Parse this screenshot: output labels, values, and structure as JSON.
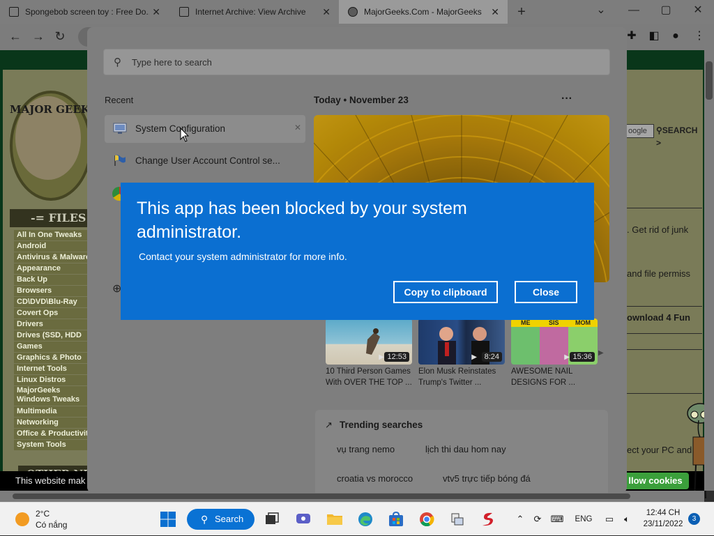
{
  "browser": {
    "tabs": [
      {
        "title": "Spongebob screen toy : Free Do...",
        "active": false
      },
      {
        "title": "Internet Archive: View Archive",
        "active": false
      },
      {
        "title": "MajorGeeks.Com - MajorGeeks",
        "active": true
      }
    ],
    "new_tab_symbol": "+",
    "window_controls": {
      "dropdown": "⌄",
      "minimize": "—",
      "maximize": "▢",
      "close": "✕"
    },
    "nav": {
      "back": "←",
      "forward": "→",
      "reload": "↻"
    },
    "toolbar_icons": [
      "extensions-icon",
      "sidebar-icon",
      "profile-icon",
      "menu-icon"
    ]
  },
  "website": {
    "logo_text": "MAJOR GEEK",
    "files_header": "-= FILES",
    "menu": [
      "All In One Tweaks",
      "Android",
      "Antivirus & Malware",
      "Appearance",
      "Back Up",
      "Browsers",
      "CD\\DVD\\Blu-Ray",
      "Covert Ops",
      "Drivers",
      "Drives (SSD, HDD",
      "Games",
      "Graphics & Photo",
      "Internet Tools",
      "Linux Distros",
      "MajorGeeks Windows Tweaks",
      "Multimedia",
      "Networking",
      "Office & Productivity",
      "System Tools"
    ],
    "other_header": "OTHER NE",
    "search_box": "oogle",
    "search_link": "SEARCH >",
    "right_snippets": [
      ". Get rid of junk",
      "and file permiss",
      "ownload 4 Fun",
      "ect your PC and"
    ],
    "cookie_text": "This website mak",
    "cookie_button": "llow cookies"
  },
  "start_panel": {
    "search_placeholder": "Type here to search",
    "recent_title": "Recent",
    "recent_items": [
      {
        "label": "System Configuration",
        "icon": "system-config-icon"
      },
      {
        "label": "Change User Account Control se...",
        "icon": "uac-flag-icon"
      }
    ],
    "recent_close": "✕",
    "today_label": "Today",
    "today_separator": "•",
    "today_date": "November 23",
    "more_symbol": "···",
    "videos": [
      {
        "duration": "12:53",
        "caption_line1": "10 Third Person Games",
        "caption_line2": "With OVER THE TOP ..."
      },
      {
        "duration": "8:24",
        "caption_line1": "Elon Musk Reinstates",
        "caption_line2": "Trump's Twitter ..."
      },
      {
        "duration": "15:36",
        "caption_line1": "AWESOME NAIL",
        "caption_line2": "DESIGNS FOR ..."
      }
    ],
    "video3_overlay": [
      "ME",
      "SIS",
      "MOM"
    ],
    "trending_title": "Trending searches",
    "trending": [
      "vụ trang nemo",
      "lịch thi dau hom nay",
      "croatia vs morocco",
      "vtv5 trực tiếp bóng đá"
    ]
  },
  "dialog": {
    "title": "This app has been blocked by your system administrator.",
    "message": "Contact your system administrator for more info.",
    "copy_button": "Copy to clipboard",
    "close_button": "Close"
  },
  "taskbar": {
    "weather_temp": "2°C",
    "weather_desc": "Có nắng",
    "search_label": "Search",
    "language": "ENG",
    "time": "12:44 CH",
    "date": "23/11/2022",
    "notification_count": "3"
  },
  "colors": {
    "dialog_blue": "#0b6fd1",
    "taskbar_search_blue": "#0a72d4",
    "panel_gray": "#7e7e7e"
  }
}
